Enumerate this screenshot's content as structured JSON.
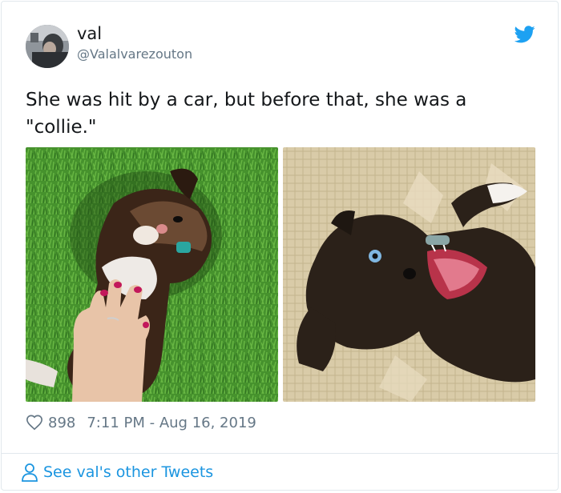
{
  "tweet": {
    "author_name": "val",
    "author_handle": "@Valalvarezouton",
    "text": "She was hit by a car, but before that, she was a \"collie.\"",
    "likes": "898",
    "timestamp": "7:11 PM - Aug 16, 2019",
    "icons": {
      "brand": "twitter-bird-icon",
      "like": "heart-icon",
      "profile": "person-icon"
    },
    "colors": {
      "brand": "#1da1f2",
      "link": "#1b95e0",
      "secondary_text": "#657786"
    }
  },
  "footer": {
    "see_more_label": "See val's other Tweets"
  }
}
